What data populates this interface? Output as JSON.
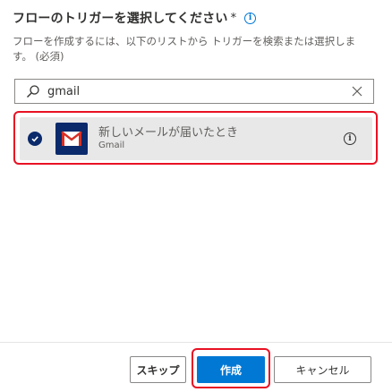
{
  "header": {
    "title": "フローのトリガーを選択してください",
    "required_mark": "*",
    "info_icon": "info-icon"
  },
  "description": "フローを作成するには、以下のリストから トリガーを検索または選択しま す。 (必須)",
  "search": {
    "value": "gmail",
    "icon": "search-icon",
    "clear_icon": "close-icon"
  },
  "results": [
    {
      "title": "新しいメールが届いたとき",
      "connector": "Gmail",
      "selected": true,
      "icon": "gmail-icon"
    }
  ],
  "footer": {
    "skip_label": "スキップ",
    "create_label": "作成",
    "cancel_label": "キャンセル"
  },
  "colors": {
    "accent": "#0078d4",
    "highlight": "#e81123",
    "connector_tile": "#0a2a6b",
    "selected_bg": "#e8e8e8"
  }
}
